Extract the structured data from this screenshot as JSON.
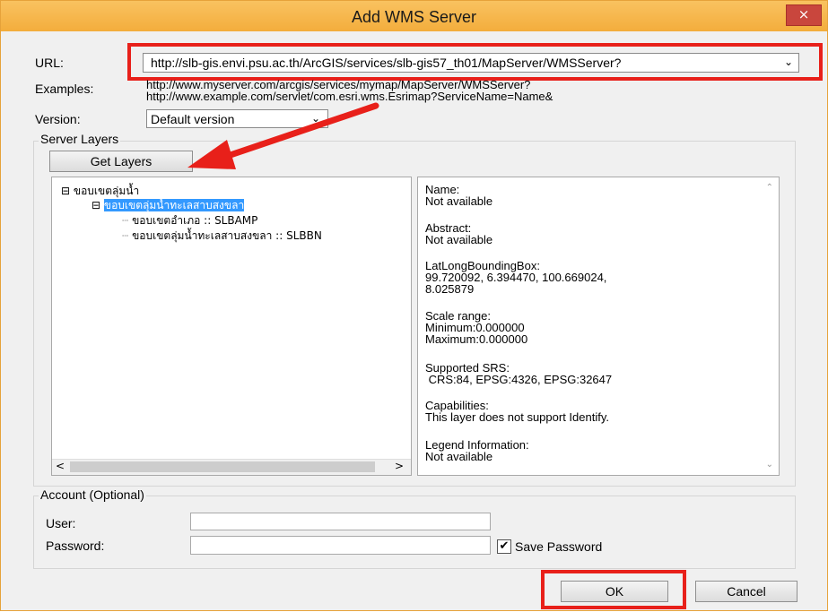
{
  "window": {
    "title": "Add WMS Server",
    "close_glyph": "×"
  },
  "url": {
    "label": "URL:",
    "value": "http://slb-gis.envi.psu.ac.th/ArcGIS/services/slb-gis57_th01/MapServer/WMSServer?"
  },
  "examples": {
    "label": "Examples:",
    "line1": "http://www.myserver.com/arcgis/services/mymap/MapServer/WMSServer?",
    "line2": "http://www.example.com/servlet/com.esri.wms.Esrimap?ServiceName=Name&"
  },
  "version": {
    "label": "Version:",
    "value": "Default version"
  },
  "server_layers": {
    "title": "Server Layers",
    "get_layers_label": "Get Layers",
    "tree": [
      {
        "label": "ขอบเขตลุ่มน้ำ",
        "expander": "⊟",
        "selected": false
      },
      {
        "label": "ขอบเขตลุ่มน้ำทะเลสาบสงขลา",
        "expander": "⊟",
        "selected": true
      },
      {
        "label": "ขอบเขตอำเภอ :: SLBAMP",
        "expander": "",
        "selected": false
      },
      {
        "label": "ขอบเขตลุ่มน้ำทะเลสาบสงขลา :: SLBBN",
        "expander": "",
        "selected": false
      }
    ],
    "scroll_left": "<",
    "scroll_right": ">"
  },
  "info": {
    "name_label": "Name:",
    "name_value": "Not available",
    "abstract_label": "Abstract:",
    "abstract_value": "Not available",
    "bbox_label": "LatLongBoundingBox:",
    "bbox_value_line1": "99.720092, 6.394470, 100.669024,",
    "bbox_value_line2": "8.025879",
    "scale_label": "Scale range:",
    "scale_min": "Minimum:0.000000",
    "scale_max": "Maximum:0.000000",
    "srs_label": "Supported SRS:",
    "srs_value": " CRS:84, EPSG:4326, EPSG:32647",
    "capabilities_label": "Capabilities:",
    "capabilities_value": "This layer does not support Identify.",
    "legend_label": "Legend Information:",
    "legend_value": "Not available"
  },
  "account": {
    "title": "Account (Optional)",
    "user_label": "User:",
    "user_value": "",
    "password_label": "Password:",
    "password_value": "",
    "save_password_label": "Save Password",
    "save_password_checked": true
  },
  "buttons": {
    "ok_label": "OK",
    "cancel_label": "Cancel"
  },
  "colors": {
    "titlebar": "#f3ad3c",
    "highlight": "#e8201a",
    "selection": "#3399ff"
  },
  "icons": [
    "close-icon",
    "dropdown-chevron-icon",
    "tree-expander-icon",
    "checkbox-check-icon",
    "annotation-arrow-icon"
  ]
}
